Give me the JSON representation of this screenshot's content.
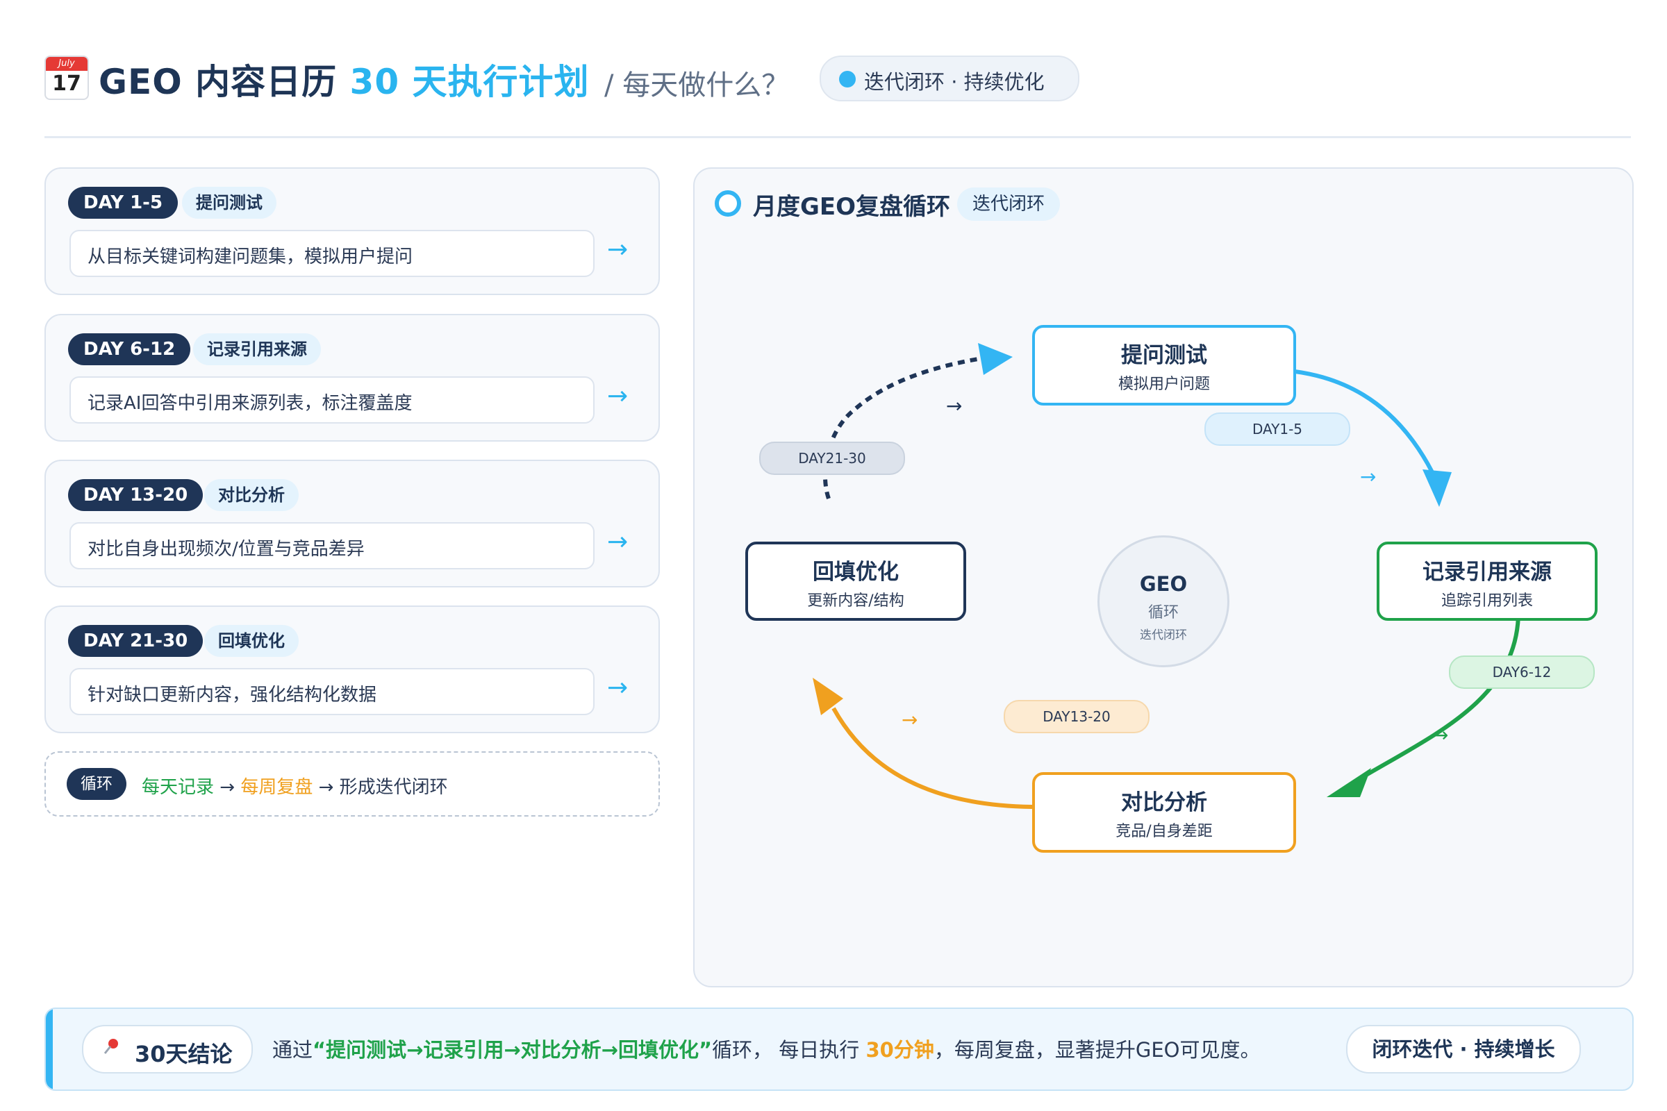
{
  "header": {
    "calendar_icon": {
      "month": "July",
      "day": "17"
    },
    "title_main": "GEO 内容日历",
    "title_accent": "30 天执行计划",
    "subtitle": "/ 每天做什么？",
    "pill": "迭代闭环 · 持续优化"
  },
  "days": [
    {
      "badge": "DAY 1-5",
      "tag": "提问测试",
      "desc": "从目标关键词构建问题集，模拟用户提问",
      "arrow": "→"
    },
    {
      "badge": "DAY 6-12",
      "tag": "记录引用来源",
      "desc": "记录AI回答中引用来源列表，标注覆盖度",
      "arrow": "→"
    },
    {
      "badge": "DAY 13-20",
      "tag": "对比分析",
      "desc": "对比自身出现频次/位置与竞品差异",
      "arrow": "→"
    },
    {
      "badge": "DAY 21-30",
      "tag": "回填优化",
      "desc": "针对缺口更新内容，强化结构化数据",
      "arrow": "→"
    }
  ],
  "loop_note": {
    "badge": "循环",
    "daily": "每天记录",
    "arrow1": " → ",
    "weekly": "每周复盘",
    "rest": " → 形成迭代闭环"
  },
  "cycle": {
    "title": "月度GEO复盘循环",
    "tag": "迭代闭环",
    "steps": {
      "test": {
        "name": "提问测试",
        "sub": "模拟用户问题"
      },
      "record": {
        "name": "记录引用来源",
        "sub": "追踪引用列表"
      },
      "compare": {
        "name": "对比分析",
        "sub": "竞品/自身差距"
      },
      "backfill": {
        "name": "回填优化",
        "sub": "更新内容/结构"
      }
    },
    "hub": {
      "title": "GEO",
      "line1": "循环",
      "line2": "迭代闭环"
    },
    "pills": {
      "p1": "DAY1-5",
      "p2": "DAY6-12",
      "p3": "DAY13-20",
      "p4": "DAY21-30"
    },
    "colors": {
      "test": "#33b5f3",
      "record": "#1fa24a",
      "compare": "#f0a01f",
      "backfill": "#1f3557"
    }
  },
  "footer": {
    "badge": "30天结论",
    "pre": "通过",
    "cycle_text": "“提问测试→记录引用→对比分析→回填优化”",
    "mid": "循环， 每日执行",
    "minutes": "30分钟",
    "post": "，每周复盘，显著提升GEO可见度。",
    "end_pill": "闭环迭代 · 持续增长"
  }
}
